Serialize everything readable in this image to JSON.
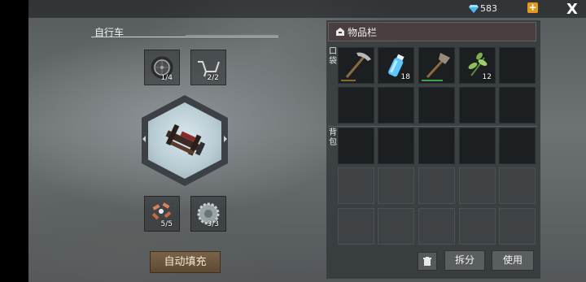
{
  "currency": {
    "gems": "583",
    "icon": "diamond-icon",
    "plus": "+"
  },
  "close_label": "X",
  "crafting": {
    "title": "自行车",
    "components": [
      {
        "name": "wheel",
        "count": "1/4"
      },
      {
        "name": "handlebar",
        "count": "2/2"
      },
      {
        "name": "pedal-parts",
        "count": "5/5"
      },
      {
        "name": "gear",
        "count": "3/3"
      }
    ],
    "auto_fill_label": "自动填充"
  },
  "inventory": {
    "title": "物品栏",
    "pocket_label": "口袋",
    "backpack_label": "背包",
    "pocket_items": [
      {
        "name": "pickaxe",
        "count": "",
        "durability": 0.5,
        "durability_color": "#8a6a2a"
      },
      {
        "name": "water-bottle",
        "count": "18"
      },
      {
        "name": "hatchet",
        "count": "",
        "durability": 0.8,
        "durability_color": "#3fa24a"
      },
      {
        "name": "plant-fiber",
        "count": "12"
      },
      {
        "name": "",
        "count": ""
      }
    ],
    "buttons": {
      "split": "拆分",
      "use": "使用"
    }
  },
  "colors": {
    "accent": "#e39a1c",
    "button": "#7a6448"
  }
}
